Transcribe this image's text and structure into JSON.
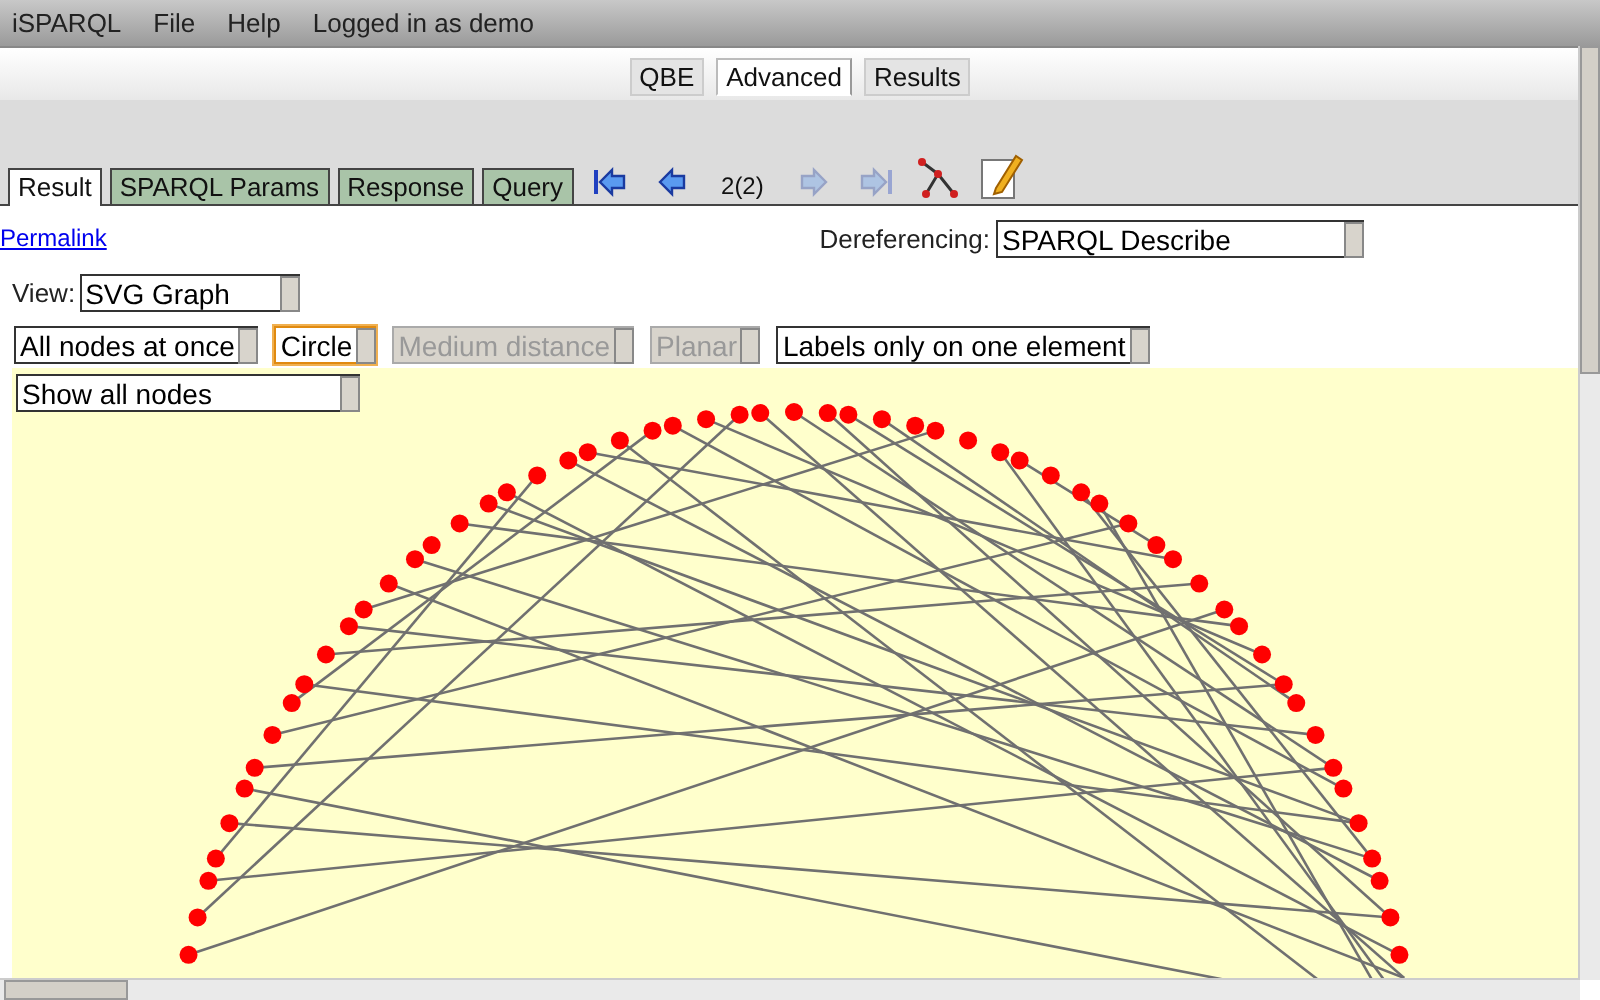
{
  "menu": [
    "iSPARQL",
    "File",
    "Help",
    "Logged in as demo"
  ],
  "mode_tabs": [
    {
      "label": "QBE",
      "selected": false
    },
    {
      "label": "Advanced",
      "selected": true
    },
    {
      "label": "Results",
      "selected": false
    }
  ],
  "result_tabs": [
    {
      "label": "Result",
      "selected": true
    },
    {
      "label": "SPARQL Params",
      "selected": false
    },
    {
      "label": "Response",
      "selected": false
    },
    {
      "label": "Query",
      "selected": false
    }
  ],
  "toolbar": [
    {
      "kind": "first",
      "disabled": false
    },
    {
      "kind": "prev",
      "disabled": false
    },
    {
      "kind": "page",
      "text": "2(2)"
    },
    {
      "kind": "next",
      "disabled": true
    },
    {
      "kind": "last",
      "disabled": true
    },
    {
      "kind": "graph",
      "disabled": false
    },
    {
      "kind": "edit",
      "disabled": false
    }
  ],
  "permalink": "Permalink",
  "dereferencing": {
    "label": "Dereferencing:",
    "value": "SPARQL Describe"
  },
  "view": {
    "label": "View:",
    "value": "SVG Graph"
  },
  "graph_options": [
    {
      "value": "All nodes at once",
      "disabled": false,
      "focused": false
    },
    {
      "value": "Circle",
      "disabled": false,
      "focused": true
    },
    {
      "value": "Medium distance",
      "disabled": true,
      "focused": false
    },
    {
      "value": "Planar",
      "disabled": true,
      "focused": false
    },
    {
      "value": "Labels only on one element",
      "disabled": false,
      "focused": false
    }
  ],
  "node_filter": {
    "value": "Show all nodes"
  }
}
